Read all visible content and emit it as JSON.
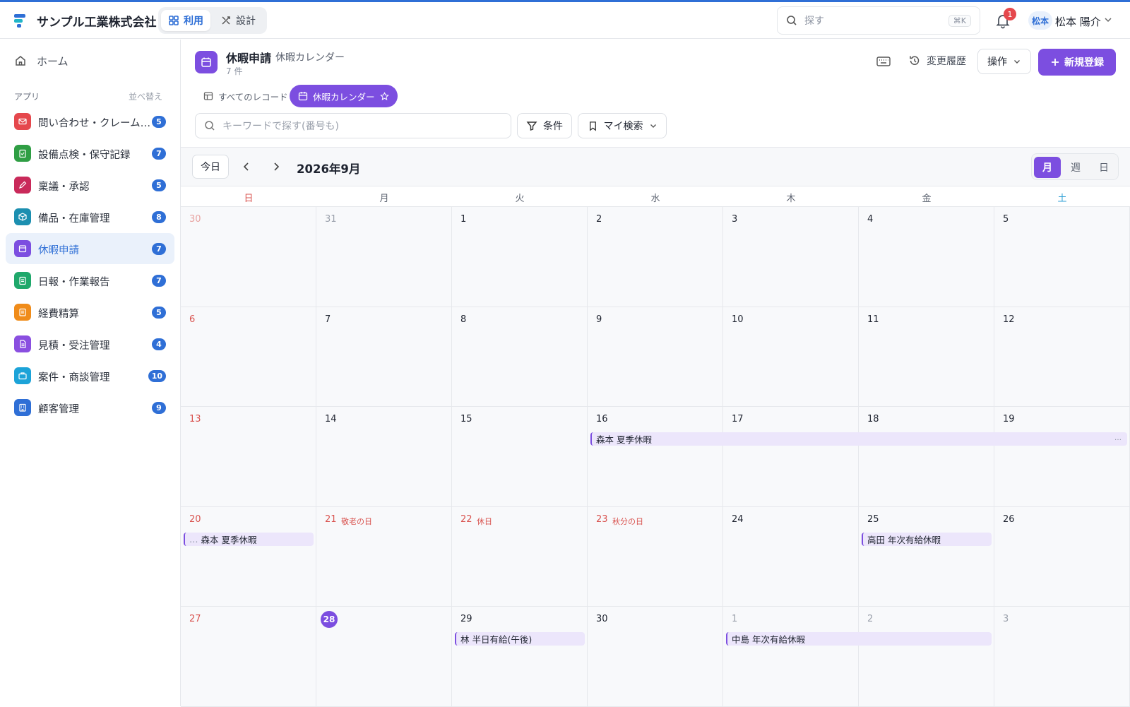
{
  "header": {
    "company": "サンプル工業株式会社",
    "mode_use": "利用",
    "mode_design": "設計",
    "search_placeholder": "探す",
    "search_shortcut": "⌘K",
    "notification_count": "1",
    "user_avatar": "松本",
    "user_name": "松本 陽介",
    "accent_color": "#2f6fd6"
  },
  "sidebar": {
    "home": "ホーム",
    "section": "アプリ",
    "sort": "並べ替え",
    "items": [
      {
        "label": "問い合わせ・クレーム管理",
        "count": "5",
        "color": "#e5484d",
        "icon": "mail-icon"
      },
      {
        "label": "設備点検・保守記録",
        "count": "7",
        "color": "#2f9e44",
        "icon": "clipboard-check-icon"
      },
      {
        "label": "稟議・承認",
        "count": "5",
        "color": "#c92a5a",
        "icon": "pen-icon"
      },
      {
        "label": "備品・在庫管理",
        "count": "8",
        "color": "#1c8fb0",
        "icon": "box-icon"
      },
      {
        "label": "休暇申請",
        "count": "7",
        "color": "#7c4ee0",
        "icon": "calendar-icon"
      },
      {
        "label": "日報・作業報告",
        "count": "7",
        "color": "#1fa86b",
        "icon": "clipboard-icon"
      },
      {
        "label": "経費精算",
        "count": "5",
        "color": "#f08c1a",
        "icon": "receipt-icon"
      },
      {
        "label": "見積・受注管理",
        "count": "4",
        "color": "#8a4fe0",
        "icon": "document-icon"
      },
      {
        "label": "案件・商談管理",
        "count": "10",
        "color": "#1ca3d8",
        "icon": "briefcase-icon"
      },
      {
        "label": "顧客管理",
        "count": "9",
        "color": "#2f6fd6",
        "icon": "building-icon"
      }
    ]
  },
  "app": {
    "title": "休暇申請",
    "subtitle": "休暇カレンダー",
    "count": "7 件",
    "history": "変更履歴",
    "ops": "操作",
    "new": "新規登録",
    "accent": "#7c4ee0"
  },
  "tabs": [
    {
      "label": "すべてのレコード"
    },
    {
      "label": "休暇カレンダー"
    }
  ],
  "filters": {
    "keyword_placeholder": "キーワードで探す(番号も)",
    "condition": "条件",
    "my_search": "マイ検索"
  },
  "calendar": {
    "today_btn": "今日",
    "month_label": "2026年9月",
    "views": [
      "月",
      "週",
      "日"
    ],
    "active_view": "月",
    "dow": [
      "日",
      "月",
      "火",
      "水",
      "木",
      "金",
      "土"
    ],
    "weeks": [
      [
        {
          "d": "30",
          "out": true
        },
        {
          "d": "31",
          "out": true
        },
        {
          "d": "1"
        },
        {
          "d": "2"
        },
        {
          "d": "3"
        },
        {
          "d": "4"
        },
        {
          "d": "5"
        }
      ],
      [
        {
          "d": "6"
        },
        {
          "d": "7"
        },
        {
          "d": "8"
        },
        {
          "d": "9"
        },
        {
          "d": "10"
        },
        {
          "d": "11"
        },
        {
          "d": "12"
        }
      ],
      [
        {
          "d": "13"
        },
        {
          "d": "14"
        },
        {
          "d": "15"
        },
        {
          "d": "16"
        },
        {
          "d": "17"
        },
        {
          "d": "18"
        },
        {
          "d": "19"
        }
      ],
      [
        {
          "d": "20"
        },
        {
          "d": "21",
          "holiday": "敬老の日"
        },
        {
          "d": "22",
          "holiday": "休日"
        },
        {
          "d": "23",
          "holiday": "秋分の日"
        },
        {
          "d": "24"
        },
        {
          "d": "25"
        },
        {
          "d": "26"
        }
      ],
      [
        {
          "d": "27"
        },
        {
          "d": "28",
          "today": true
        },
        {
          "d": "29"
        },
        {
          "d": "30"
        },
        {
          "d": "1",
          "out": true
        },
        {
          "d": "2",
          "out": true
        },
        {
          "d": "3",
          "out": true
        }
      ]
    ],
    "events": [
      {
        "title": "森本 夏季休暇",
        "week": 2,
        "start": 3,
        "span": 4,
        "cont_right": true
      },
      {
        "title": "森本 夏季休暇",
        "week": 3,
        "start": 0,
        "span": 1,
        "cont_left": true
      },
      {
        "title": "高田 年次有給休暇",
        "week": 3,
        "start": 5,
        "span": 1
      },
      {
        "title": "林 半日有給(午後)",
        "week": 4,
        "start": 2,
        "span": 1
      },
      {
        "title": "中島 年次有給休暇",
        "week": 4,
        "start": 4,
        "span": 2
      }
    ]
  }
}
